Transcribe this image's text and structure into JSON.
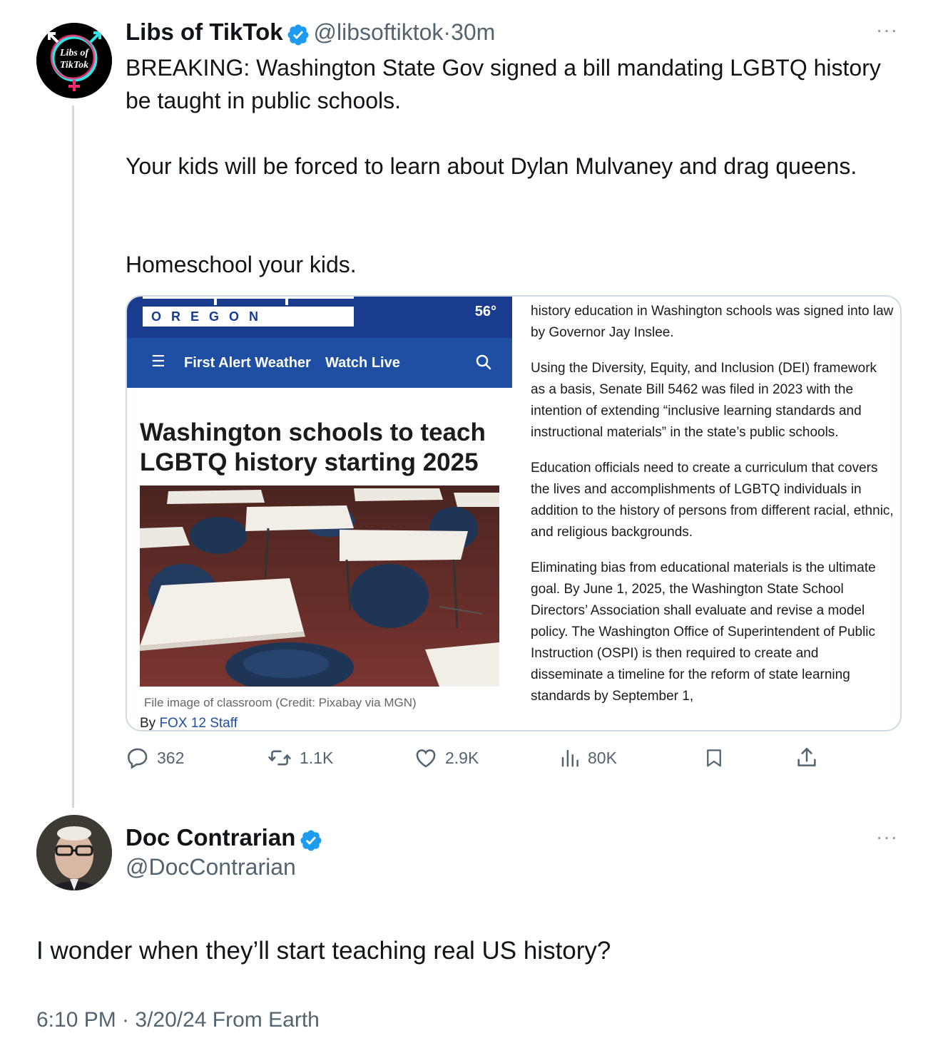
{
  "original_tweet": {
    "author_name": "Libs of TikTok",
    "handle": "@libsoftiktok",
    "separator": "·",
    "time": "30m",
    "avatar_text_line1": "Libs of",
    "avatar_text_line2": "TikTok",
    "text_p1": "BREAKING: Washington State Gov signed a bill mandating LGBTQ history be taught in public schools.",
    "text_p2": "Your kids will be forced to learn about Dylan Mulvaney and drag queens.",
    "text_p3": "Homeschool your kids.",
    "more_label": "···"
  },
  "article_card": {
    "station": "OREGON",
    "temperature": "56°",
    "nav_menu_icon": "☰",
    "nav_items": [
      "First Alert Weather",
      "Watch Live"
    ],
    "headline": "Washington schools to teach LGBTQ history starting 2025",
    "image_caption": "File image of classroom  (Credit: Pixabay via MGN)",
    "byline_prefix": "By ",
    "byline_author": "FOX 12 Staff",
    "body_p1": "history education in Washington schools was signed into law by Governor Jay Inslee.",
    "body_p2": "Using the Diversity, Equity, and Inclusion (DEI) framework as a basis, Senate Bill 5462 was filed in 2023 with the intention of extending “inclusive learning standards and instructional materials” in the state’s public schools.",
    "body_p3": "Education officials need to create a curriculum that covers the lives and accomplishments of LGBTQ individuals in addition to the history of persons from different racial, ethnic, and religious backgrounds.",
    "body_p4": "Eliminating bias from educational materials is the ultimate goal. By June 1, 2025, the Washington State School Directors’ Association shall evaluate and revise a model policy. The Washington Office of Superintendent of Public Instruction (OSPI) is then required to create and disseminate a timeline for the reform of state learning standards by September 1,"
  },
  "actions": {
    "replies": "362",
    "reposts": "1.1K",
    "likes": "2.9K",
    "views": "80K"
  },
  "reply_tweet": {
    "author_name": "Doc Contrarian",
    "handle": "@DocContrarian",
    "text": "I wonder when they’ll start teaching real US history?",
    "timestamp": "6:10 PM · 3/20/24 From Earth",
    "more_label": "···"
  },
  "colors": {
    "verified_blue": "#1d9bf0",
    "secondary_text": "#536471",
    "fox_blue": "#1e4fa3"
  }
}
